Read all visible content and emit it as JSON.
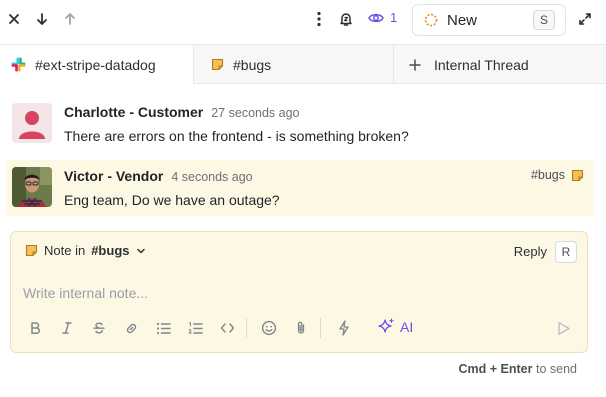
{
  "topbar": {
    "watchers_count": "1",
    "status_label": "New",
    "status_shortcut": "S"
  },
  "tabs": [
    {
      "label": "#ext-stripe-datadog"
    },
    {
      "label": "#bugs"
    },
    {
      "label": "Internal Thread"
    }
  ],
  "messages": [
    {
      "author": "Charlotte - Customer",
      "time": "27 seconds ago",
      "text": "There are errors on the frontend - is something broken?"
    },
    {
      "author": "Victor - Vendor",
      "time": "4 seconds ago",
      "text": "Eng team, Do we have an outage?",
      "tag": "#bugs"
    }
  ],
  "composer": {
    "note_prefix": "Note in",
    "note_channel": "#bugs",
    "reply_label": "Reply",
    "reply_shortcut": "R",
    "placeholder": "Write internal note...",
    "ai_label": "AI"
  },
  "send_hint": {
    "keys": "Cmd + Enter",
    "suffix": "to send"
  },
  "colors": {
    "accent": "#6b4ee6",
    "note_bg": "#fdf8e3",
    "status_ring": "#e8891c"
  }
}
